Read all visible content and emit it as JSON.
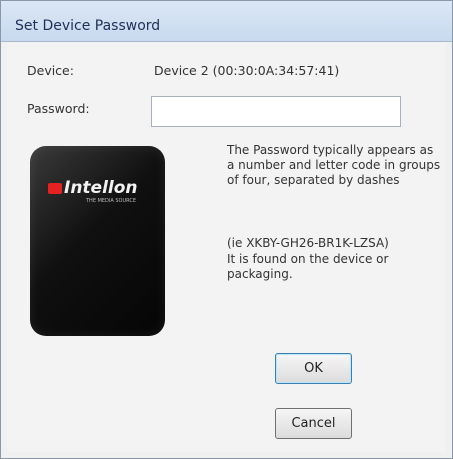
{
  "window": {
    "title": "Set Device Password"
  },
  "form": {
    "device_label": "Device:",
    "device_value": "Device 2  (00:30:0A:34:57:41)",
    "password_label": "Password:",
    "password_value": ""
  },
  "image": {
    "brand": "Intellon",
    "subtitle": "THE MEDIA SOURCE"
  },
  "help": {
    "line1": "The Password typically appears as a number and letter code in groups of four, separated by dashes",
    "line2": "(ie XKBY-GH26-BR1K-LZSA)",
    "line3": "It is found on the device or packaging."
  },
  "buttons": {
    "ok": "OK",
    "cancel": "Cancel"
  },
  "colors": {
    "titlebar": "#c8d9ee",
    "background": "#f3f3f3",
    "default_button_border": "#3c7fb1",
    "logo_red": "#e42222"
  }
}
